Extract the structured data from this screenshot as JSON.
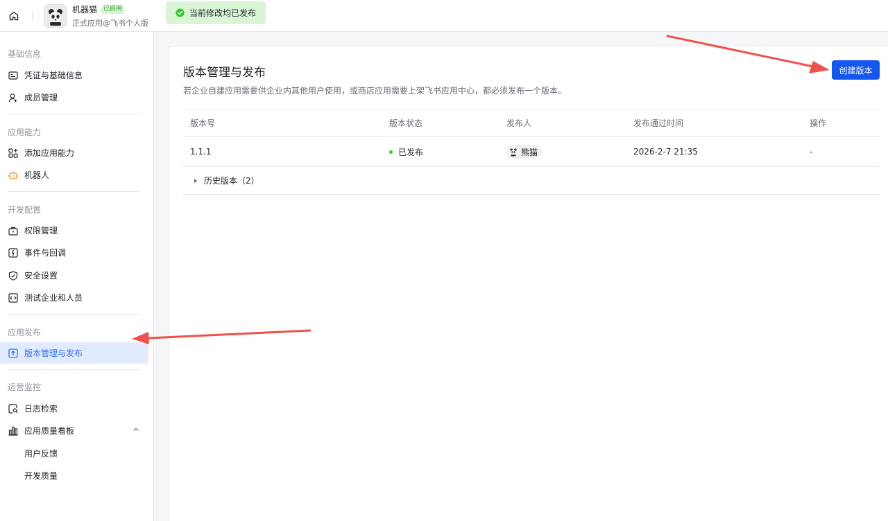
{
  "topbar": {
    "app_name": "机器猫",
    "app_badge": "已启用",
    "app_sub": "正式应用@飞书个人版",
    "publish_status": "当前修改均已发布"
  },
  "sidebar": {
    "sections": [
      {
        "title": "基础信息",
        "items": [
          {
            "label": "凭证与基础信息",
            "icon": "credential-icon"
          },
          {
            "label": "成员管理",
            "icon": "member-icon"
          }
        ]
      },
      {
        "title": "应用能力",
        "items": [
          {
            "label": "添加应用能力",
            "icon": "add-capability-icon"
          },
          {
            "label": "机器人",
            "icon": "robot-icon"
          }
        ]
      },
      {
        "title": "开发配置",
        "items": [
          {
            "label": "权限管理",
            "icon": "permission-icon"
          },
          {
            "label": "事件与回调",
            "icon": "event-icon"
          },
          {
            "label": "安全设置",
            "icon": "shield-icon"
          },
          {
            "label": "测试企业和人员",
            "icon": "code-icon"
          }
        ]
      },
      {
        "title": "应用发布",
        "items": [
          {
            "label": "版本管理与发布",
            "icon": "upload-icon",
            "active": true
          }
        ]
      },
      {
        "title": "运营监控",
        "items": [
          {
            "label": "日志检索",
            "icon": "log-search-icon"
          },
          {
            "label": "应用质量看板",
            "icon": "bar-chart-icon",
            "expanded": true
          },
          {
            "label": "用户反馈"
          },
          {
            "label": "开发质量"
          }
        ]
      }
    ]
  },
  "main": {
    "title": "版本管理与发布",
    "description": "若企业自建应用需要供企业内其他用户使用，或商店应用需要上架飞书应用中心，都必须发布一个版本。",
    "create_button": "创建版本",
    "table": {
      "headers": [
        "版本号",
        "版本状态",
        "发布人",
        "发布通过时间",
        "操作"
      ],
      "rows": [
        {
          "version": "1.1.1",
          "status": "已发布",
          "publisher": "熊猫",
          "time": "2026-2-7 21:35",
          "action": "-"
        }
      ],
      "history_label": "历史版本（2）"
    }
  },
  "colors": {
    "primary": "#1456f0",
    "active_bg": "#e1eaff",
    "success": "#34c724",
    "annotation_arrow": "#f0504a"
  }
}
